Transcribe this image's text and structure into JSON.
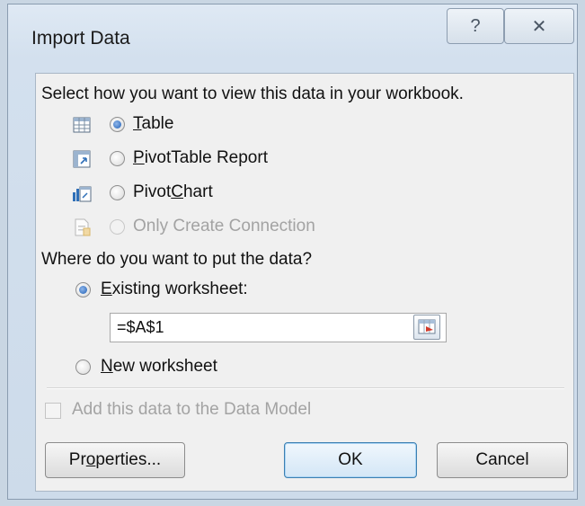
{
  "window": {
    "title": "Import Data",
    "help_glyph": "?",
    "close_glyph": "✕"
  },
  "view_section": {
    "prompt": "Select how you want to view this data in your workbook.",
    "options": [
      {
        "pre": "",
        "key": "T",
        "post": "able",
        "selected": true,
        "enabled": true,
        "icon": "table-icon"
      },
      {
        "pre": "",
        "key": "P",
        "post": "ivotTable Report",
        "selected": false,
        "enabled": true,
        "icon": "pivottable-icon"
      },
      {
        "pre": "Pivot",
        "key": "C",
        "post": "hart",
        "selected": false,
        "enabled": true,
        "icon": "pivotchart-icon"
      },
      {
        "pre": "",
        "key": "",
        "post": "Only Create Connection",
        "selected": false,
        "enabled": false,
        "icon": "connection-icon"
      }
    ]
  },
  "location_section": {
    "prompt": "Where do you want to put the data?",
    "existing": {
      "key": "E",
      "post": "xisting worksheet:",
      "selected": true
    },
    "reference_value": "=$A$1",
    "new_sheet": {
      "key": "N",
      "post": "ew worksheet",
      "selected": false
    }
  },
  "data_model": {
    "label": "Add this data to the Data Model",
    "checked": false,
    "enabled": false
  },
  "buttons": {
    "properties": {
      "pre": "Pr",
      "key": "o",
      "post": "perties..."
    },
    "ok": "OK",
    "cancel": "Cancel"
  }
}
